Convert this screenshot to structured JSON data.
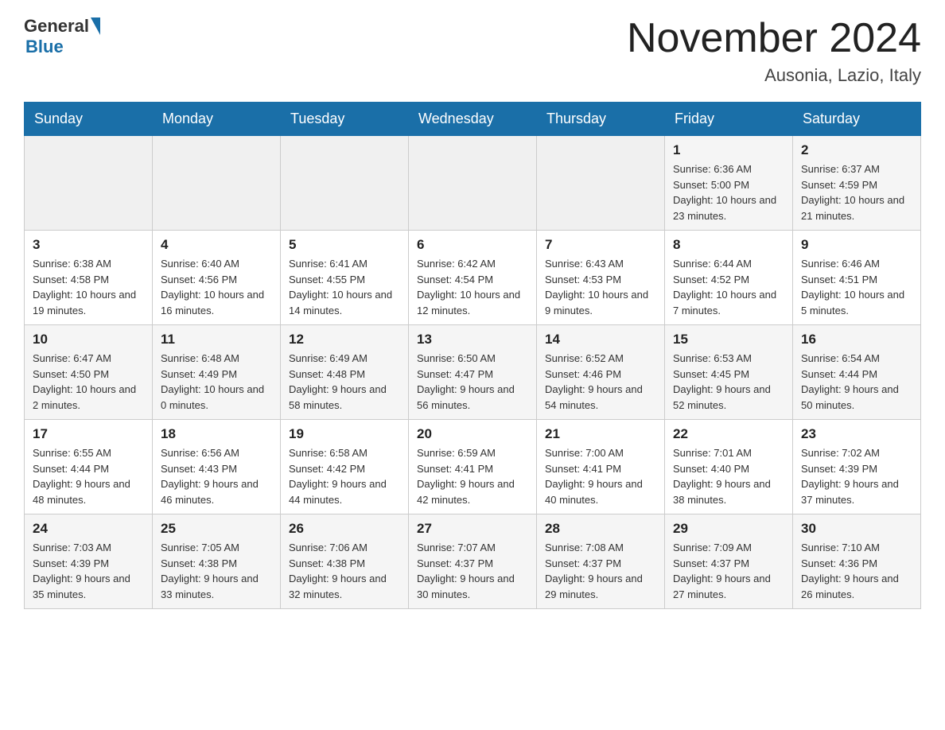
{
  "header": {
    "logo_general": "General",
    "logo_blue": "Blue",
    "title": "November 2024",
    "location": "Ausonia, Lazio, Italy"
  },
  "days_of_week": [
    "Sunday",
    "Monday",
    "Tuesday",
    "Wednesday",
    "Thursday",
    "Friday",
    "Saturday"
  ],
  "weeks": [
    [
      {
        "day": "",
        "info": ""
      },
      {
        "day": "",
        "info": ""
      },
      {
        "day": "",
        "info": ""
      },
      {
        "day": "",
        "info": ""
      },
      {
        "day": "",
        "info": ""
      },
      {
        "day": "1",
        "info": "Sunrise: 6:36 AM\nSunset: 5:00 PM\nDaylight: 10 hours and 23 minutes."
      },
      {
        "day": "2",
        "info": "Sunrise: 6:37 AM\nSunset: 4:59 PM\nDaylight: 10 hours and 21 minutes."
      }
    ],
    [
      {
        "day": "3",
        "info": "Sunrise: 6:38 AM\nSunset: 4:58 PM\nDaylight: 10 hours and 19 minutes."
      },
      {
        "day": "4",
        "info": "Sunrise: 6:40 AM\nSunset: 4:56 PM\nDaylight: 10 hours and 16 minutes."
      },
      {
        "day": "5",
        "info": "Sunrise: 6:41 AM\nSunset: 4:55 PM\nDaylight: 10 hours and 14 minutes."
      },
      {
        "day": "6",
        "info": "Sunrise: 6:42 AM\nSunset: 4:54 PM\nDaylight: 10 hours and 12 minutes."
      },
      {
        "day": "7",
        "info": "Sunrise: 6:43 AM\nSunset: 4:53 PM\nDaylight: 10 hours and 9 minutes."
      },
      {
        "day": "8",
        "info": "Sunrise: 6:44 AM\nSunset: 4:52 PM\nDaylight: 10 hours and 7 minutes."
      },
      {
        "day": "9",
        "info": "Sunrise: 6:46 AM\nSunset: 4:51 PM\nDaylight: 10 hours and 5 minutes."
      }
    ],
    [
      {
        "day": "10",
        "info": "Sunrise: 6:47 AM\nSunset: 4:50 PM\nDaylight: 10 hours and 2 minutes."
      },
      {
        "day": "11",
        "info": "Sunrise: 6:48 AM\nSunset: 4:49 PM\nDaylight: 10 hours and 0 minutes."
      },
      {
        "day": "12",
        "info": "Sunrise: 6:49 AM\nSunset: 4:48 PM\nDaylight: 9 hours and 58 minutes."
      },
      {
        "day": "13",
        "info": "Sunrise: 6:50 AM\nSunset: 4:47 PM\nDaylight: 9 hours and 56 minutes."
      },
      {
        "day": "14",
        "info": "Sunrise: 6:52 AM\nSunset: 4:46 PM\nDaylight: 9 hours and 54 minutes."
      },
      {
        "day": "15",
        "info": "Sunrise: 6:53 AM\nSunset: 4:45 PM\nDaylight: 9 hours and 52 minutes."
      },
      {
        "day": "16",
        "info": "Sunrise: 6:54 AM\nSunset: 4:44 PM\nDaylight: 9 hours and 50 minutes."
      }
    ],
    [
      {
        "day": "17",
        "info": "Sunrise: 6:55 AM\nSunset: 4:44 PM\nDaylight: 9 hours and 48 minutes."
      },
      {
        "day": "18",
        "info": "Sunrise: 6:56 AM\nSunset: 4:43 PM\nDaylight: 9 hours and 46 minutes."
      },
      {
        "day": "19",
        "info": "Sunrise: 6:58 AM\nSunset: 4:42 PM\nDaylight: 9 hours and 44 minutes."
      },
      {
        "day": "20",
        "info": "Sunrise: 6:59 AM\nSunset: 4:41 PM\nDaylight: 9 hours and 42 minutes."
      },
      {
        "day": "21",
        "info": "Sunrise: 7:00 AM\nSunset: 4:41 PM\nDaylight: 9 hours and 40 minutes."
      },
      {
        "day": "22",
        "info": "Sunrise: 7:01 AM\nSunset: 4:40 PM\nDaylight: 9 hours and 38 minutes."
      },
      {
        "day": "23",
        "info": "Sunrise: 7:02 AM\nSunset: 4:39 PM\nDaylight: 9 hours and 37 minutes."
      }
    ],
    [
      {
        "day": "24",
        "info": "Sunrise: 7:03 AM\nSunset: 4:39 PM\nDaylight: 9 hours and 35 minutes."
      },
      {
        "day": "25",
        "info": "Sunrise: 7:05 AM\nSunset: 4:38 PM\nDaylight: 9 hours and 33 minutes."
      },
      {
        "day": "26",
        "info": "Sunrise: 7:06 AM\nSunset: 4:38 PM\nDaylight: 9 hours and 32 minutes."
      },
      {
        "day": "27",
        "info": "Sunrise: 7:07 AM\nSunset: 4:37 PM\nDaylight: 9 hours and 30 minutes."
      },
      {
        "day": "28",
        "info": "Sunrise: 7:08 AM\nSunset: 4:37 PM\nDaylight: 9 hours and 29 minutes."
      },
      {
        "day": "29",
        "info": "Sunrise: 7:09 AM\nSunset: 4:37 PM\nDaylight: 9 hours and 27 minutes."
      },
      {
        "day": "30",
        "info": "Sunrise: 7:10 AM\nSunset: 4:36 PM\nDaylight: 9 hours and 26 minutes."
      }
    ]
  ]
}
